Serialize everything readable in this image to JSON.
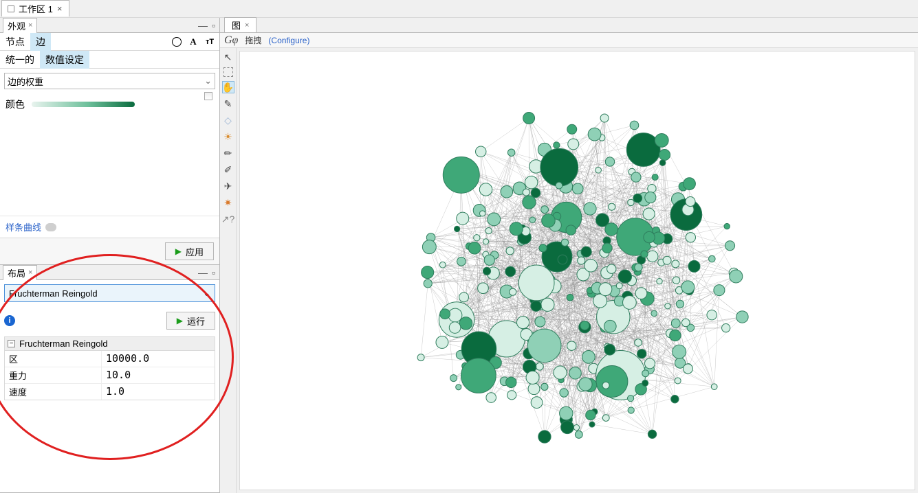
{
  "top": {
    "workspace_tab": "工作区 1",
    "close": "×"
  },
  "appearance": {
    "panel_title": "外观",
    "close": "×",
    "tabs": {
      "nodes": "节点",
      "edges": "边"
    },
    "modes": {
      "uniform": "统一的",
      "ranking": "数值设定"
    },
    "attribute": "边的权重",
    "color_label": "颜色",
    "spline": "样条曲线",
    "apply": "应用"
  },
  "layout": {
    "panel_title": "布局",
    "close": "×",
    "algorithm": "Fruchterman Reingold",
    "run": "运行",
    "section": "Fruchterman Reingold",
    "props": [
      {
        "k": "区",
        "v": "10000.0"
      },
      {
        "k": "重力",
        "v": "10.0"
      },
      {
        "k": "速度",
        "v": "1.0"
      }
    ]
  },
  "graph": {
    "tab": "图",
    "close": "×",
    "toolbar_label": "拖拽",
    "configure": "(Configure)"
  }
}
